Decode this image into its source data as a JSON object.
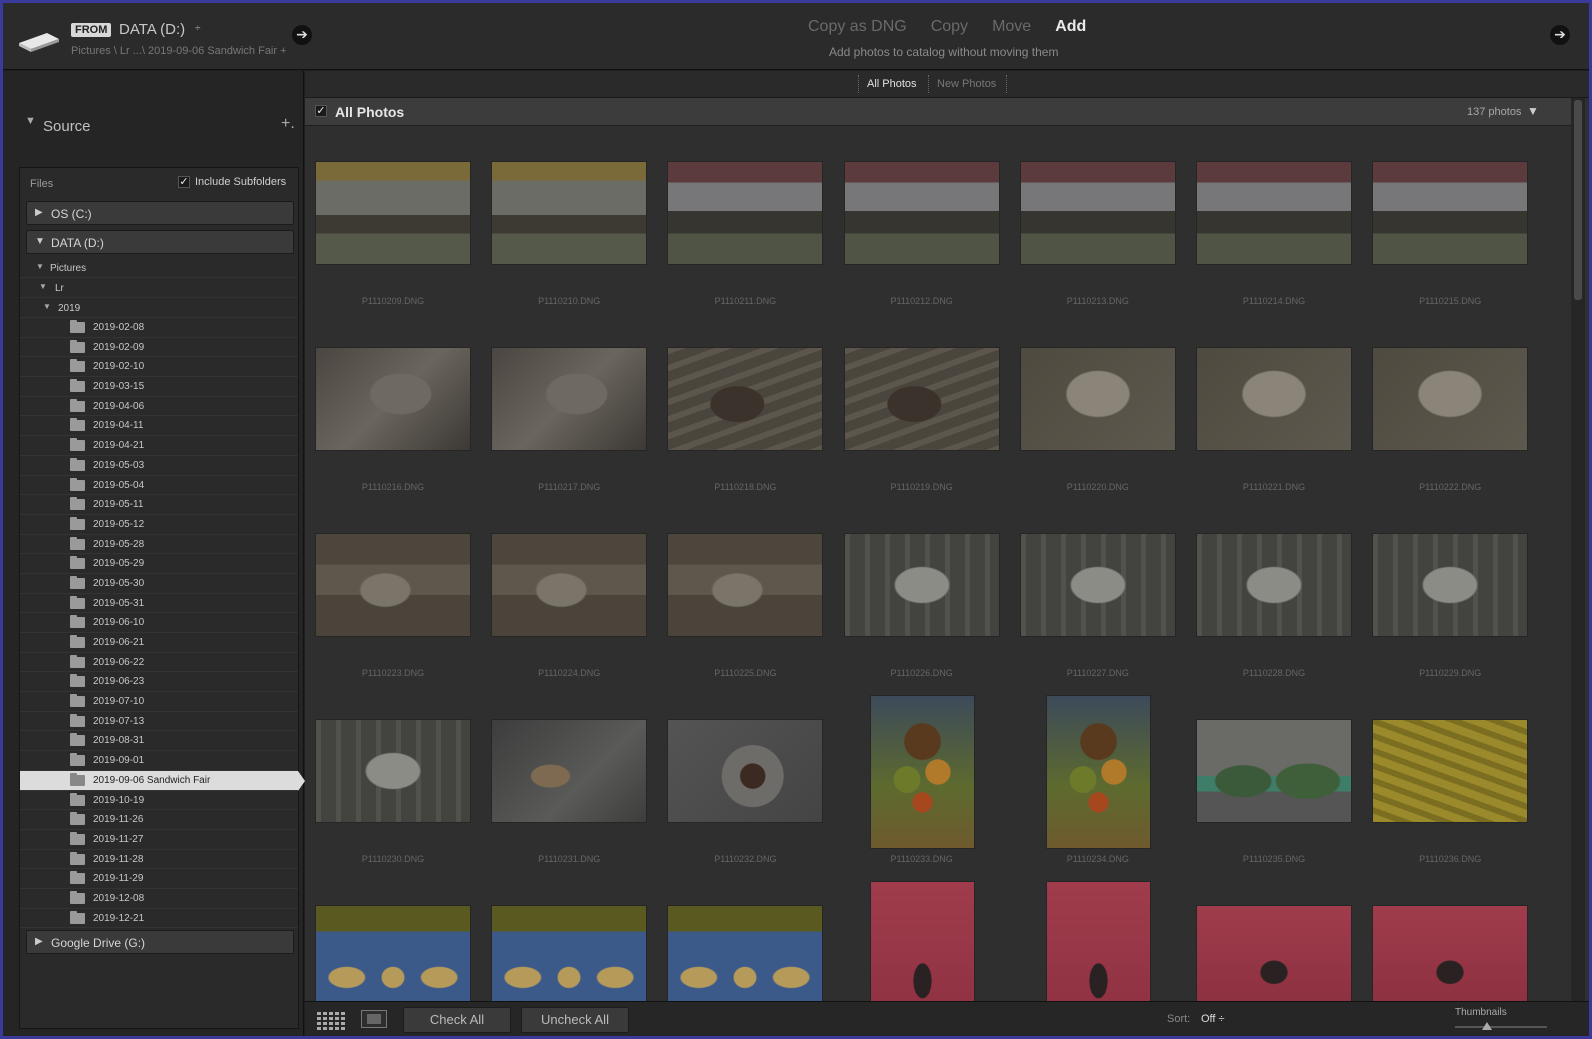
{
  "from_panel": {
    "badge": "FROM",
    "drive": "DATA (D:)",
    "drive_toggle": "÷",
    "path": "Pictures \\ Lr ...\\ 2019-09-06 Sandwich Fair +",
    "nav_arrow": "➔"
  },
  "import_modes": {
    "items": [
      "Copy as DNG",
      "Copy",
      "Move",
      "Add"
    ],
    "active": "Add",
    "description": "Add photos to catalog without moving them"
  },
  "right_arrow": "➔",
  "source": {
    "title": "Source",
    "add": "+.",
    "files_label": "Files",
    "include_subfolders": "Include Subfolders",
    "include_subfolders_checked": true,
    "volumes": {
      "os": "OS (C:)",
      "data": "DATA (D:)",
      "gdrive": "Google Drive (G:)"
    },
    "tree": {
      "pictures": "Pictures",
      "lr": "Lr",
      "year": "2019"
    },
    "folders": [
      "2019-02-08",
      "2019-02-09",
      "2019-02-10",
      "2019-03-15",
      "2019-04-06",
      "2019-04-11",
      "2019-04-21",
      "2019-05-03",
      "2019-05-04",
      "2019-05-11",
      "2019-05-12",
      "2019-05-28",
      "2019-05-29",
      "2019-05-30",
      "2019-05-31",
      "2019-06-10",
      "2019-06-21",
      "2019-06-22",
      "2019-06-23",
      "2019-07-10",
      "2019-07-13",
      "2019-08-31",
      "2019-09-01",
      "2019-09-06 Sandwich Fair",
      "2019-10-19",
      "2019-11-26",
      "2019-11-27",
      "2019-11-28",
      "2019-11-29",
      "2019-12-08",
      "2019-12-21"
    ],
    "selected_folder": "2019-09-06 Sandwich Fair"
  },
  "view_tabs": {
    "all": "All Photos",
    "new": "New Photos"
  },
  "grid": {
    "title": "All Photos",
    "count": "137 photos",
    "photos": [
      {
        "name": "P1110209.DNG",
        "scene": "cattle"
      },
      {
        "name": "P1110210.DNG",
        "scene": "cattle"
      },
      {
        "name": "P1110211.DNG",
        "scene": "cattle-red"
      },
      {
        "name": "P1110212.DNG",
        "scene": "cattle-red"
      },
      {
        "name": "P1110213.DNG",
        "scene": "cattle-red"
      },
      {
        "name": "P1110214.DNG",
        "scene": "cattle-red"
      },
      {
        "name": "P1110215.DNG",
        "scene": "cattle-red"
      },
      {
        "name": "P1110216.DNG",
        "scene": "sheep"
      },
      {
        "name": "P1110217.DNG",
        "scene": "sheep"
      },
      {
        "name": "P1110218.DNG",
        "scene": "sheep-pen"
      },
      {
        "name": "P1110219.DNG",
        "scene": "sheep-pen"
      },
      {
        "name": "P1110220.DNG",
        "scene": "sheep-white"
      },
      {
        "name": "P1110221.DNG",
        "scene": "sheep-white"
      },
      {
        "name": "P1110222.DNG",
        "scene": "sheep-white"
      },
      {
        "name": "P1110223.DNG",
        "scene": "sheep-fence"
      },
      {
        "name": "P1110224.DNG",
        "scene": "sheep-fence"
      },
      {
        "name": "P1110225.DNG",
        "scene": "sheep-fence"
      },
      {
        "name": "P1110226.DNG",
        "scene": "goat"
      },
      {
        "name": "P1110227.DNG",
        "scene": "goat"
      },
      {
        "name": "P1110228.DNG",
        "scene": "goat"
      },
      {
        "name": "P1110229.DNG",
        "scene": "goat"
      },
      {
        "name": "P1110230.DNG",
        "scene": "goat"
      },
      {
        "name": "P1110231.DNG",
        "scene": "barn"
      },
      {
        "name": "P1110232.DNG",
        "scene": "pie"
      },
      {
        "name": "P1110233.DNG",
        "scene": "vegetables",
        "orientation": "portrait"
      },
      {
        "name": "P1110234.DNG",
        "scene": "vegetables",
        "orientation": "portrait"
      },
      {
        "name": "P1110235.DNG",
        "scene": "pumpkins"
      },
      {
        "name": "P1110236.DNG",
        "scene": "corn"
      },
      {
        "name": "",
        "scene": "wheat"
      },
      {
        "name": "",
        "scene": "wheat"
      },
      {
        "name": "",
        "scene": "wheat"
      },
      {
        "name": "",
        "scene": "stage",
        "orientation": "portrait"
      },
      {
        "name": "",
        "scene": "stage",
        "orientation": "portrait"
      },
      {
        "name": "",
        "scene": "stage"
      },
      {
        "name": "",
        "scene": "stage"
      }
    ]
  },
  "bottom": {
    "check_all": "Check All",
    "uncheck_all": "Uncheck All",
    "sort_label": "Sort:",
    "sort_value": "Off ÷",
    "thumbnails_label": "Thumbnails",
    "thumbnail_size": 0.35
  }
}
